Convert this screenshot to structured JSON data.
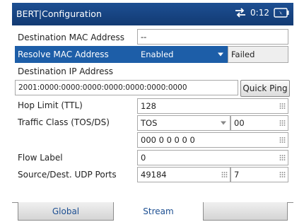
{
  "window": {
    "title": "BERT|Configuration",
    "clock": "0:12"
  },
  "fields": {
    "dest_mac": {
      "label": "Destination MAC Address",
      "value": "--"
    },
    "resolve_mac": {
      "label": "Resolve MAC Address",
      "value": "Enabled",
      "status": "Failed"
    },
    "dest_ip": {
      "label": "Destination IP Address",
      "value": "2001:0000:0000:0000:0000:0000:0000:0000",
      "button": "Quick Ping"
    },
    "hop_limit": {
      "label": "Hop Limit (TTL)",
      "value": "128"
    },
    "traffic_class": {
      "label": "Traffic Class (TOS/DS)",
      "mode": "TOS",
      "value": "00",
      "bits": "000 0 0 0 0 0"
    },
    "flow_label": {
      "label": "Flow Label",
      "value": "0"
    },
    "udp_ports": {
      "label": "Source/Dest. UDP Ports",
      "source": "49184",
      "dest": "7"
    }
  },
  "tabs": [
    {
      "label": "Global",
      "active": false
    },
    {
      "label": "Stream",
      "active": true
    },
    {
      "label": "",
      "active": false
    }
  ],
  "colors": {
    "titlebar": "#1d4f92",
    "selection": "#1d5ea8",
    "tab_text": "#1d4f92"
  }
}
